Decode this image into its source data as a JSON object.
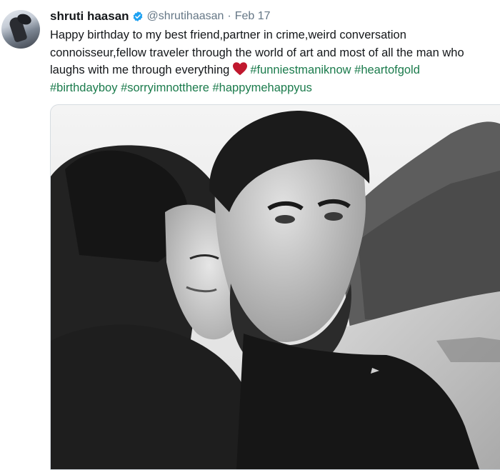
{
  "tweet": {
    "author_name": "shruti haasan",
    "handle": "@shrutihaasan",
    "separator": "·",
    "date": "Feb 17",
    "verified_icon": "verified-badge-icon",
    "text": {
      "line1": "Happy birthday to my best friend,partner in crime,weird conversation",
      "line2": "connoisseur,fellow traveler through the world of art and most of all the man who",
      "line3_prefix": "laughs with me through everything",
      "heart_icon": "heart-icon",
      "hashtags_line3": [
        "#funniestmaniknow",
        "#heartofgold"
      ],
      "hashtags_line4": [
        "#birthdayboy",
        "#sorryimnotthere",
        "#happymehappyus"
      ]
    },
    "colors": {
      "name": "#14171a",
      "meta": "#657786",
      "hashtag": "#1b7b4c",
      "verified": "#1da1f2",
      "heart": "#c0182e"
    }
  }
}
